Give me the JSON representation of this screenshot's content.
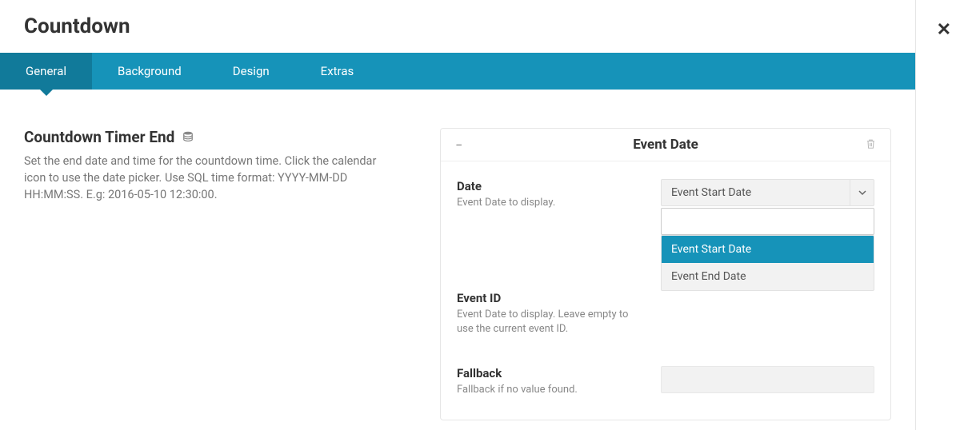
{
  "header": {
    "title": "Countdown"
  },
  "tabs": [
    {
      "label": "General",
      "active": true
    },
    {
      "label": "Background",
      "active": false
    },
    {
      "label": "Design",
      "active": false
    },
    {
      "label": "Extras",
      "active": false
    }
  ],
  "section": {
    "title": "Countdown Timer End",
    "description": "Set the end date and time for the countdown time. Click the calendar icon to use the date picker. Use SQL time format: YYYY-MM-DD HH:MM:SS. E.g: 2016-05-10 12:30:00."
  },
  "panel": {
    "title": "Event Date",
    "fields": {
      "date": {
        "label": "Date",
        "sub": "Event Date to display.",
        "selected": "Event Start Date",
        "options": [
          "Event Start Date",
          "Event End Date"
        ],
        "search_value": ""
      },
      "event_id": {
        "label": "Event ID",
        "sub": "Event Date to display. Leave empty to use the current event ID.",
        "value": ""
      },
      "fallback": {
        "label": "Fallback",
        "sub": "Fallback if no value found.",
        "value": ""
      }
    }
  }
}
